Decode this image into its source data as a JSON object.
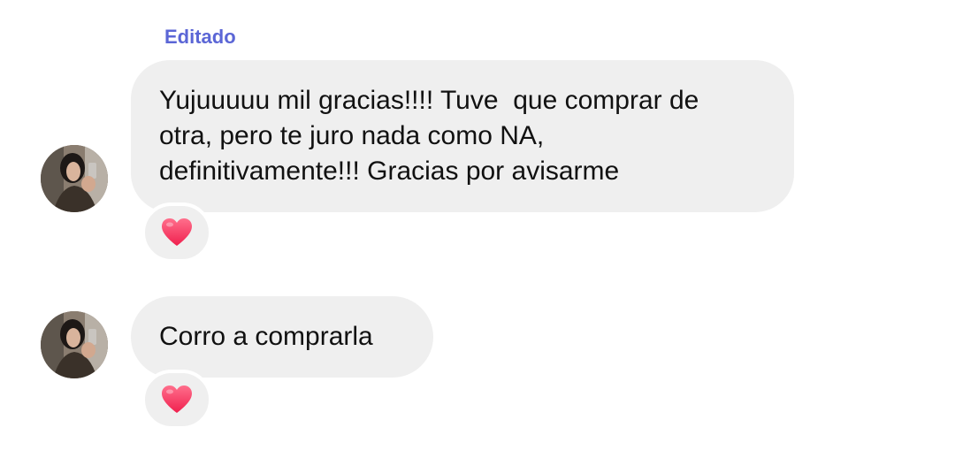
{
  "messages": [
    {
      "edited_label": "Editado",
      "lines": [
        "Yujuuuuu mil gracias!!!! Tuve  que comprar de",
        "otra, pero te juro nada como NA,",
        "definitivamente!!! Gracias por avisarme"
      ],
      "reaction": "heart-icon"
    },
    {
      "lines": [
        "Corro a comprarla"
      ],
      "reaction": "heart-icon"
    }
  ],
  "colors": {
    "bubble": "#efefef",
    "edited": "#5b66d6",
    "heart": "#f7375e",
    "text": "#111111"
  }
}
